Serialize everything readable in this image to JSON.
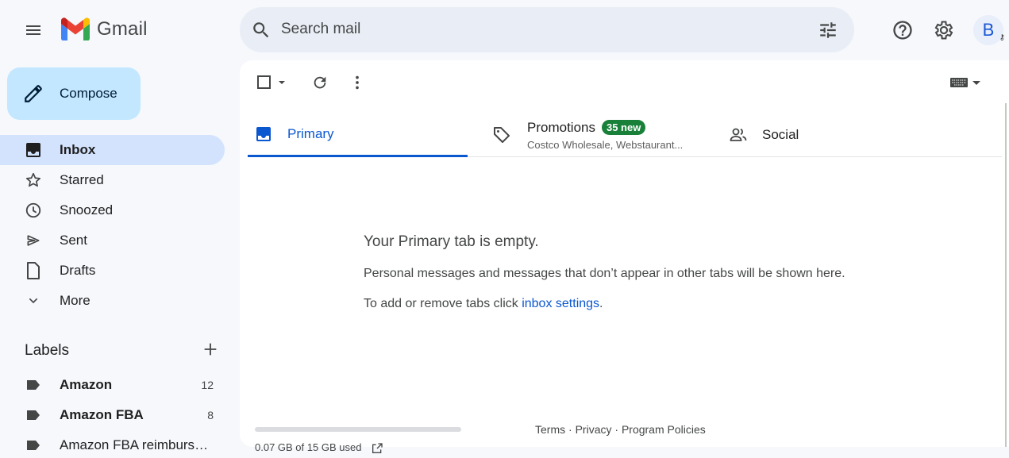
{
  "header": {
    "app_name": "Gmail",
    "search_placeholder": "Search mail",
    "avatar_letter": "B"
  },
  "sidebar": {
    "compose_label": "Compose",
    "nav": [
      {
        "label": "Inbox",
        "icon": "inbox-icon",
        "active": true
      },
      {
        "label": "Starred",
        "icon": "star-icon"
      },
      {
        "label": "Snoozed",
        "icon": "clock-icon"
      },
      {
        "label": "Sent",
        "icon": "send-icon"
      },
      {
        "label": "Drafts",
        "icon": "draft-icon"
      },
      {
        "label": "More",
        "icon": "chevron-down-icon"
      }
    ],
    "labels_title": "Labels",
    "labels": [
      {
        "name": "Amazon",
        "count": "12",
        "bold": true
      },
      {
        "name": "Amazon FBA",
        "count": "8",
        "bold": true
      },
      {
        "name": "Amazon FBA reimburse...",
        "count": "",
        "bold": false
      }
    ]
  },
  "tabs": {
    "primary": "Primary",
    "promotions": "Promotions",
    "promotions_badge": "35 new",
    "promotions_senders": "Costco Wholesale, Webstaurant...",
    "social": "Social"
  },
  "empty_state": {
    "title": "Your Primary tab is empty.",
    "description": "Personal messages and messages that don’t appear in other tabs will be shown here.",
    "hint_prefix": "To add or remove tabs click ",
    "hint_link": "inbox settings",
    "hint_suffix": "."
  },
  "footer": {
    "terms": "Terms",
    "privacy": "Privacy",
    "policies": "Program Policies",
    "separator": " · ",
    "storage": "0.07 GB of 15 GB used"
  },
  "colors": {
    "accent": "#0b57d0",
    "compose_bg": "#c2e7ff",
    "active_nav": "#d3e3fd",
    "badge_green": "#188038",
    "page_bg": "#f6f8fc"
  }
}
